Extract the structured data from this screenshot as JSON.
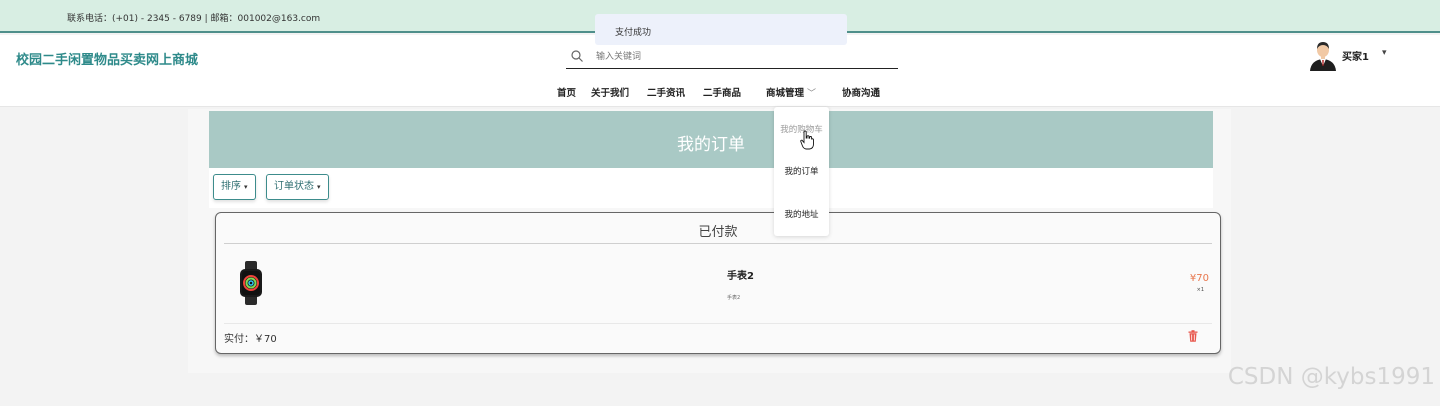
{
  "topbar": {
    "contact": "联系电话：(+01) - 2345 - 6789 | 邮箱：001002@163.com"
  },
  "toast": {
    "message": "支付成功"
  },
  "header": {
    "site_title": "校园二手闲置物品买卖网上商城",
    "search_placeholder": "输入关键词",
    "nav": [
      {
        "label": "首页"
      },
      {
        "label": "关于我们"
      },
      {
        "label": "二手资讯"
      },
      {
        "label": "二手商品"
      },
      {
        "label": "商城管理",
        "chevron": "﹀"
      },
      {
        "label": "协商沟通"
      }
    ],
    "user": {
      "name": "买家1",
      "caret": "▾"
    }
  },
  "dropdown": {
    "items": [
      {
        "label": "我的购物车"
      },
      {
        "label": "我的订单"
      },
      {
        "label": "我的地址"
      }
    ]
  },
  "page": {
    "title": "我的订单",
    "sort_label": "排序",
    "status_filter_label": "订单状态",
    "caret": "▾"
  },
  "order": {
    "status": "已付款",
    "product_name": "手表2",
    "product_sub": "手表2",
    "price": "¥70",
    "quantity": "×1",
    "paid_total": "实付：￥70"
  },
  "watermark": "CSDN @kybs1991",
  "colors": {
    "topbar_bg": "#d8eee3",
    "brand_teal": "#2e8a8a",
    "banner_bg": "#a9c9c5",
    "price": "#e8774d"
  },
  "icons": [
    "search-icon",
    "avatar-icon",
    "chevron-down-icon",
    "watch-image",
    "trash-icon",
    "hand-cursor-icon"
  ]
}
